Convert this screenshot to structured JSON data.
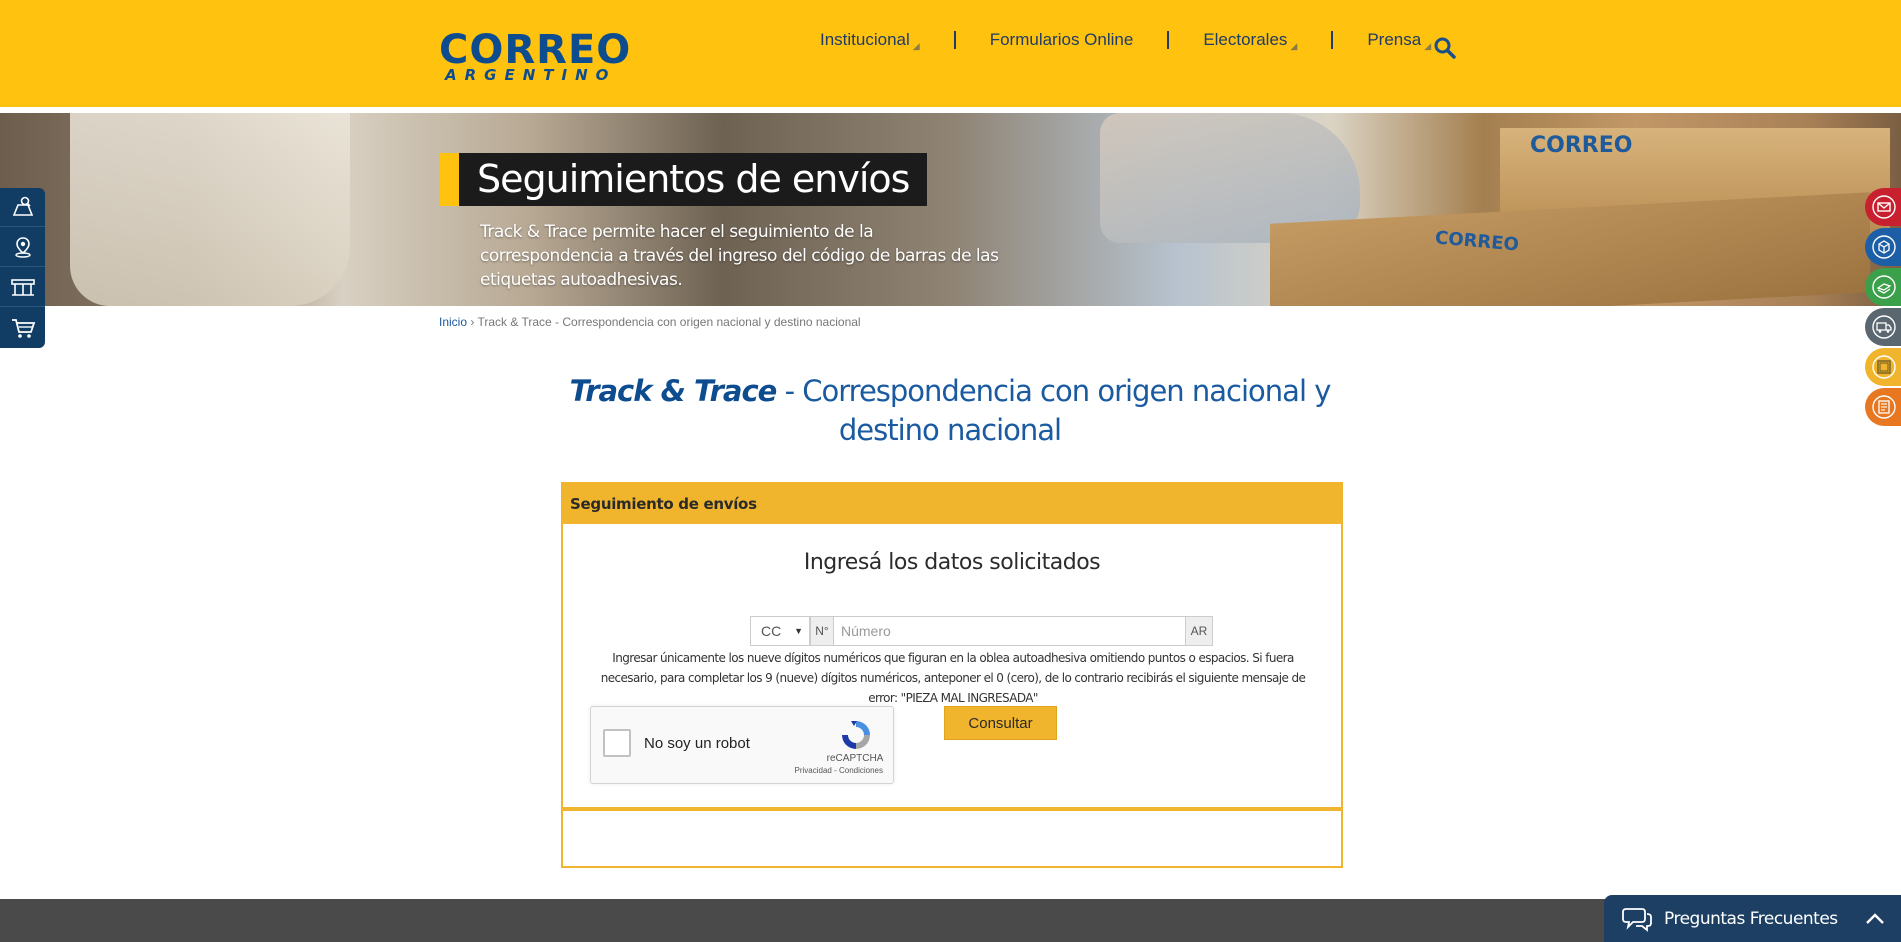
{
  "header": {
    "logo_main": "CORREO",
    "logo_sub": "ARGENTINO",
    "nav": [
      {
        "label": "Institucional",
        "has_dropdown": true
      },
      {
        "label": "Formularios Online",
        "has_dropdown": false
      },
      {
        "label": "Electorales",
        "has_dropdown": true
      },
      {
        "label": "Prensa",
        "has_dropdown": true
      }
    ],
    "search_icon": "search-icon"
  },
  "hero": {
    "title": "Seguimientos de envíos",
    "description": "Track & Trace permite hacer el seguimiento de la correspondencia a través del ingreso del código de barras de las etiquetas autoadhesivas.",
    "box_stamp": "CORREO ARGENTINO"
  },
  "left_panel": {
    "icons": [
      "map-pin-search-icon",
      "location-pin-icon",
      "branch-building-icon",
      "shopping-cart-icon"
    ]
  },
  "right_panel": {
    "buttons": [
      {
        "icon": "envelope-icon",
        "color": "#c8202f"
      },
      {
        "icon": "package-icon",
        "color": "#1d5fa6"
      },
      {
        "icon": "money-icon",
        "color": "#3aa04a"
      },
      {
        "icon": "delivery-truck-icon",
        "color": "#5b6770"
      },
      {
        "icon": "box-icon",
        "color": "#f0b52c"
      },
      {
        "icon": "document-icon",
        "color": "#e87722"
      }
    ]
  },
  "breadcrumb": {
    "home": "Inicio",
    "separator": "›",
    "current": "Track & Trace - Correspondencia con origen nacional y destino nacional"
  },
  "page_heading": {
    "bold": "Track & Trace",
    "rest": " - Correspondencia con origen nacional y destino nacional"
  },
  "panel": {
    "header": "Seguimiento de envíos",
    "subtitle": "Ingresá los datos solicitados",
    "select_value": "CC",
    "number_prefix": "N°",
    "number_placeholder": "Número",
    "suffix": "AR",
    "help_text": "Ingresar únicamente los nueve dígitos numéricos que figuran en la oblea autoadhesiva omitiendo puntos o espacios. Si fuera necesario, para completar los 9 (nueve) dígitos numéricos, anteponer el 0 (cero), de lo contrario recibirás el siguiente mensaje de error: \"PIEZA MAL INGRESADA\"",
    "captcha_label": "No soy un robot",
    "captcha_brand": "reCAPTCHA",
    "captcha_links": "Privacidad - Condiciones",
    "submit_label": "Consultar"
  },
  "faq": {
    "label": "Preguntas Frecuentes"
  },
  "colors": {
    "brand_yellow": "#ffc20e",
    "brand_blue": "#0d4c8f",
    "panel_yellow": "#f0b52c",
    "footer_gray": "#4a4a4a",
    "faq_blue": "#1d3f63"
  }
}
